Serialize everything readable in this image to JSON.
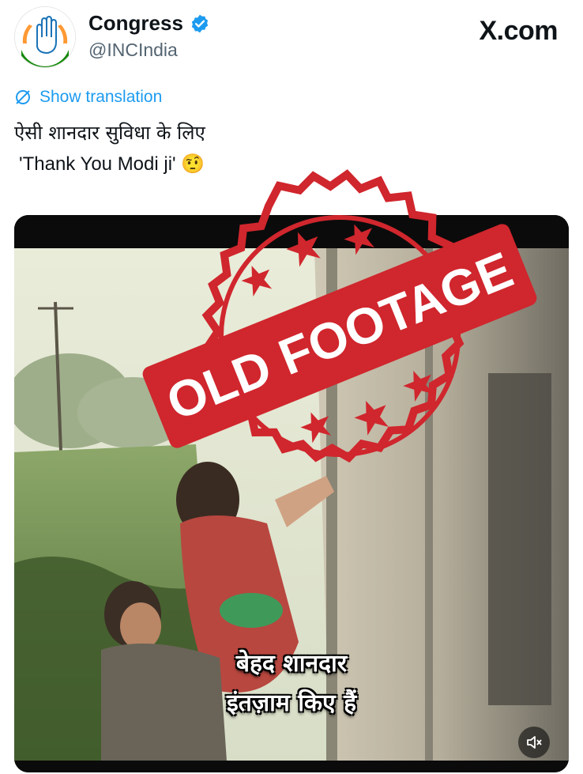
{
  "header": {
    "name": "Congress",
    "handle": "@INCIndia",
    "site": "X.com",
    "avatar_icon": "congress-hand-logo-icon",
    "verified_icon": "verified-badge-icon",
    "verified_color": "#1d9bf0"
  },
  "tweet": {
    "translate_label": "Show translation",
    "line1": "ऐसी शानदार सुविधा के लिए",
    "line2": "'Thank You Modi ji' 🤨"
  },
  "video": {
    "subtitle_line1": "बेहद शानदार",
    "subtitle_line2": "इंतज़ाम किए हैं",
    "mute_icon": "speaker-muted-icon"
  },
  "stamp": {
    "text": "OLD FOOTAGE",
    "color": "#d0262d"
  }
}
